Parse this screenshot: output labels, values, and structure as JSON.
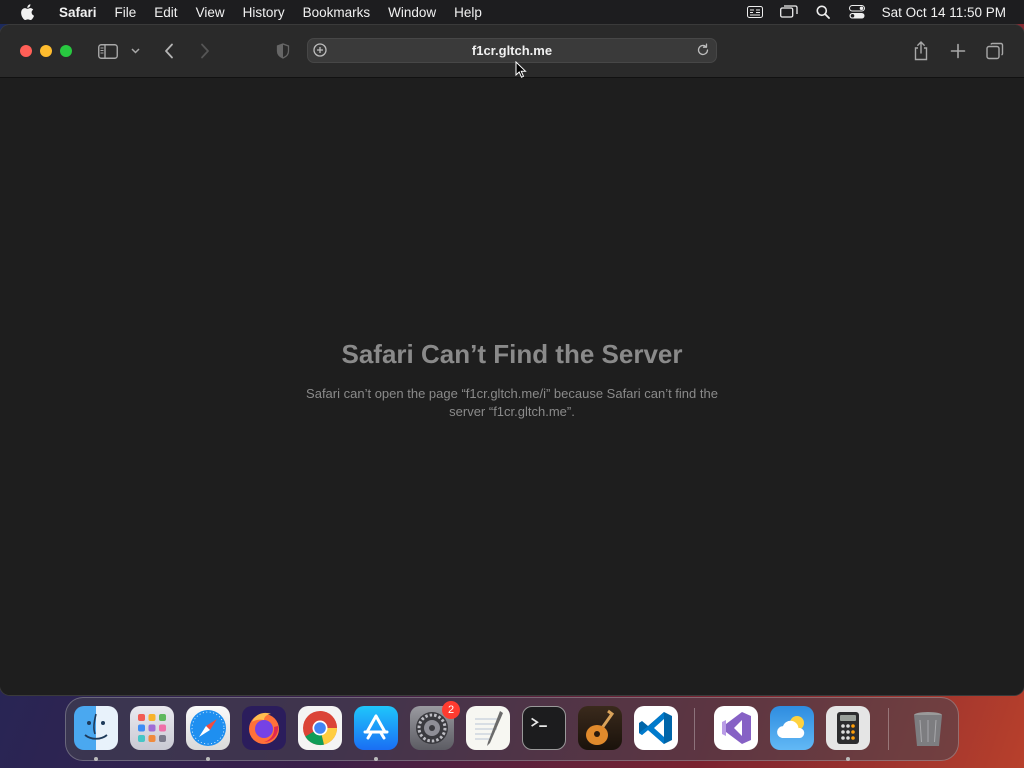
{
  "menubar": {
    "app_name": "Safari",
    "items": [
      "File",
      "Edit",
      "View",
      "History",
      "Bookmarks",
      "Window",
      "Help"
    ],
    "clock": "Sat Oct 14  11:50 PM",
    "status_icons": [
      "keyboard-input-icon",
      "screen-mirroring-icon",
      "spotlight-search-icon",
      "control-center-icon"
    ]
  },
  "browser": {
    "url": "f1cr.gltch.me",
    "error_title": "Safari Can’t Find the Server",
    "error_message": "Safari can’t open the page “f1cr.gltch.me/i” because Safari can’t find the server “f1cr.gltch.me”."
  },
  "dock": {
    "apps": [
      {
        "name": "Finder",
        "icon": "finder-icon",
        "running": true
      },
      {
        "name": "Launchpad",
        "icon": "launchpad-icon",
        "running": false
      },
      {
        "name": "Safari",
        "icon": "safari-icon",
        "running": true
      },
      {
        "name": "Firefox",
        "icon": "firefox-icon",
        "running": false
      },
      {
        "name": "Google Chrome",
        "icon": "chrome-icon",
        "running": false
      },
      {
        "name": "App Store",
        "icon": "app-store-icon",
        "running": true
      },
      {
        "name": "System Settings",
        "icon": "system-settings-icon",
        "running": false,
        "badge": "2"
      },
      {
        "name": "TextEdit",
        "icon": "textedit-icon",
        "running": false
      },
      {
        "name": "Terminal",
        "icon": "terminal-icon",
        "running": false
      },
      {
        "name": "GarageBand",
        "icon": "garageband-icon",
        "running": false
      },
      {
        "name": "Visual Studio Code",
        "icon": "vscode-icon",
        "running": false
      },
      {
        "name": "Visual Studio",
        "icon": "visual-studio-icon",
        "running": false
      },
      {
        "name": "Weather",
        "icon": "weather-icon",
        "running": false
      },
      {
        "name": "Calculator",
        "icon": "calculator-icon",
        "running": true
      },
      {
        "name": "Trash",
        "icon": "trash-icon",
        "running": false
      }
    ]
  },
  "colors": {
    "close": "#ff5f57",
    "minimize": "#febc2e",
    "maximize": "#28c840",
    "badge": "#ff3b30"
  }
}
